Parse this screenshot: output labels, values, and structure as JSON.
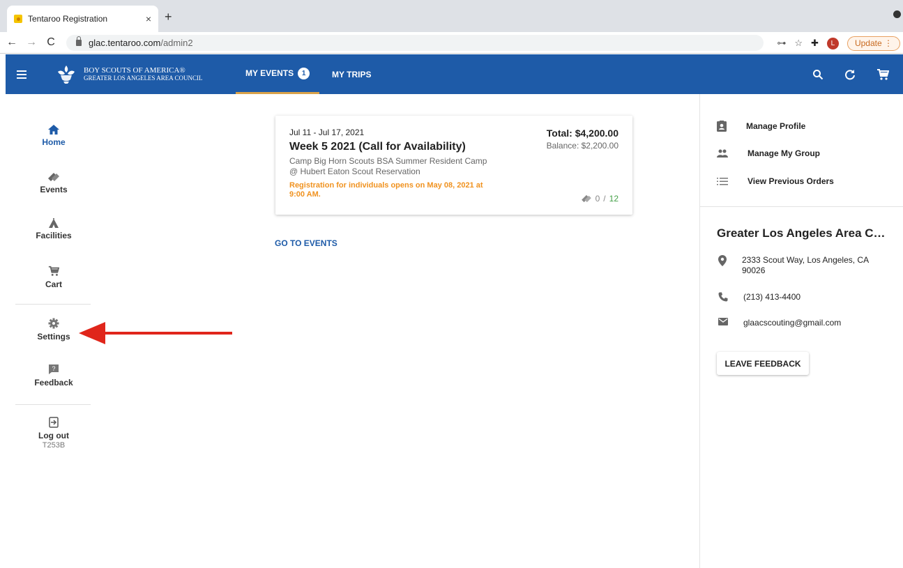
{
  "browser": {
    "tab_title": "Tentaroo Registration",
    "tab_close": "×",
    "new_tab": "+",
    "url_host": "glac.tentaroo.com",
    "url_path": "/admin2",
    "profile_initial": "L",
    "update_label": "Update"
  },
  "header": {
    "org_line1": "BOY SCOUTS OF AMERICA®",
    "org_line2": "GREATER LOS ANGELES AREA COUNCIL",
    "tabs": [
      {
        "label": "MY EVENTS",
        "badge": "1"
      },
      {
        "label": "MY TRIPS"
      }
    ]
  },
  "sidebar": {
    "items": [
      {
        "label": "Home"
      },
      {
        "label": "Events"
      },
      {
        "label": "Facilities"
      },
      {
        "label": "Cart"
      },
      {
        "label": "Settings"
      },
      {
        "label": "Feedback"
      },
      {
        "label": "Log out",
        "sub": "T253B"
      }
    ]
  },
  "event": {
    "dates": "Jul 11 - Jul 17, 2021",
    "title": "Week 5 2021 (Call for Availability)",
    "camp_line1": "Camp Big Horn Scouts BSA Summer Resident Camp",
    "camp_line2": "@ Hubert Eaton Scout Reservation",
    "notice": "Registration for individuals opens on May 08, 2021 at 9:00 AM.",
    "total": "Total: $4,200.00",
    "balance": "Balance: $2,200.00",
    "registered": "0",
    "separator": "/",
    "capacity": "12"
  },
  "main": {
    "goto_events": "GO TO EVENTS"
  },
  "rightpanel": {
    "links": [
      {
        "label": "Manage Profile"
      },
      {
        "label": "Manage My Group"
      },
      {
        "label": "View Previous Orders"
      }
    ],
    "council_name": "Greater Los Angeles Area C…",
    "address_line1": "2333 Scout Way, Los Angeles, CA",
    "address_line2": "90026",
    "phone": "(213) 413-4400",
    "email": "glaacscouting@gmail.com",
    "feedback_button": "LEAVE FEEDBACK"
  },
  "colors": {
    "brand_blue": "#1e5ba8",
    "notice_orange": "#f0921f",
    "capacity_green": "#43a047",
    "arrow_red": "#e0261b"
  }
}
